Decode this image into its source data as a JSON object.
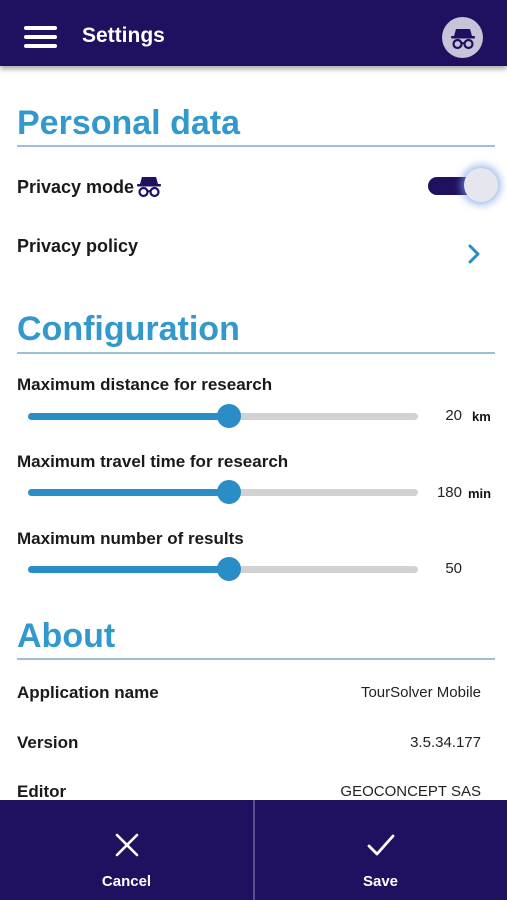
{
  "header": {
    "title": "Settings",
    "menu_icon": "hamburger-menu-icon",
    "avatar_icon": "incognito-icon"
  },
  "personal": {
    "title": "Personal data",
    "privacy_mode_label": "Privacy mode",
    "privacy_mode_icon": "incognito-icon",
    "privacy_mode_on": true,
    "privacy_policy_label": "Privacy policy"
  },
  "configuration": {
    "title": "Configuration",
    "sliders": [
      {
        "label": "Maximum distance for research",
        "value": "20",
        "unit": "km",
        "fraction": 0.5
      },
      {
        "label": "Maximum travel time for research",
        "value": "180",
        "unit": "min",
        "fraction": 0.5
      },
      {
        "label": "Maximum number of results",
        "value": "50",
        "unit": "",
        "fraction": 0.5
      }
    ]
  },
  "about": {
    "title": "About",
    "rows": [
      {
        "label": "Application name",
        "value": "TourSolver Mobile"
      },
      {
        "label": "Version",
        "value": "3.5.34.177"
      },
      {
        "label": "Editor",
        "value": "GEOCONCEPT SAS"
      }
    ]
  },
  "footer": {
    "cancel_label": "Cancel",
    "save_label": "Save"
  },
  "colors": {
    "primary": "#20105f",
    "accent": "#3399cc",
    "slider": "#2a8dc5"
  }
}
